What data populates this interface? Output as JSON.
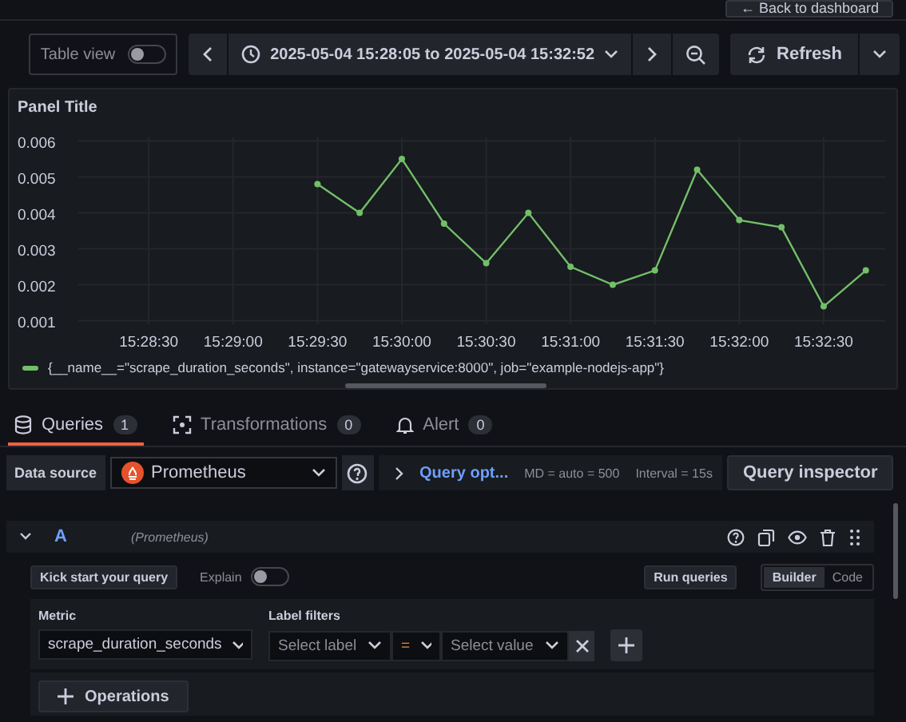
{
  "header": {
    "back_button": "← Back to dashboard"
  },
  "toolbar": {
    "table_view": {
      "label": "Table view",
      "on": false
    },
    "time_range": "2025-05-04 15:28:05 to 2025-05-04 15:32:52",
    "refresh": "Refresh"
  },
  "panel": {
    "title": "Panel Title",
    "chart_data": {
      "type": "line",
      "categories": [
        "15:28:30",
        null,
        "15:29:00",
        null,
        "15:29:30",
        null,
        "15:30:00",
        null,
        "15:30:30",
        null,
        "15:31:00",
        null,
        "15:31:30",
        null,
        "15:32:00",
        null,
        "15:32:30",
        null
      ],
      "ylim": [
        0.0009,
        0.0061
      ],
      "grid": true,
      "yticks": [
        0.001,
        0.002,
        0.003,
        0.004,
        0.005,
        0.006
      ],
      "series": [
        {
          "name": "{__name__=\"scrape_duration_seconds\", instance=\"gatewayservice:8000\", job=\"example-nodejs-app\"}",
          "color": "#73bf69",
          "marker": "circle",
          "values": [
            null,
            null,
            null,
            null,
            0.0048,
            0.004,
            0.0055,
            0.0037,
            0.0026,
            0.004,
            0.0025,
            0.002,
            0.0024,
            0.0052,
            0.0038,
            0.0036,
            0.0014,
            0.0024
          ]
        }
      ]
    }
  },
  "tabs": [
    {
      "label": "Queries",
      "count": "1",
      "selected": true,
      "kind": "database"
    },
    {
      "label": "Transformations",
      "count": "0",
      "selected": false,
      "kind": "transform"
    },
    {
      "label": "Alert",
      "count": "0",
      "selected": false,
      "kind": "bell"
    }
  ],
  "datasource_row": {
    "label": "Data source",
    "datasource": "Prometheus",
    "query_options": "Query opt...",
    "max_data_points": "MD = auto = 500",
    "interval": "Interval = 15s",
    "inspector": "Query inspector"
  },
  "query": {
    "letter": "A",
    "source": "(Prometheus)",
    "kick_start": "Kick start your query",
    "explain": {
      "label": "Explain",
      "on": false
    },
    "run_queries": "Run queries",
    "modes": [
      {
        "label": "Builder",
        "selected": true
      },
      {
        "label": "Code",
        "selected": false
      }
    ],
    "metric": {
      "label": "Metric",
      "value": "scrape_duration_seconds"
    },
    "label_filters": {
      "label": "Label filters",
      "label_placeholder": "Select label",
      "operator": "=",
      "value_placeholder": "Select value"
    },
    "operations": "Operations"
  }
}
